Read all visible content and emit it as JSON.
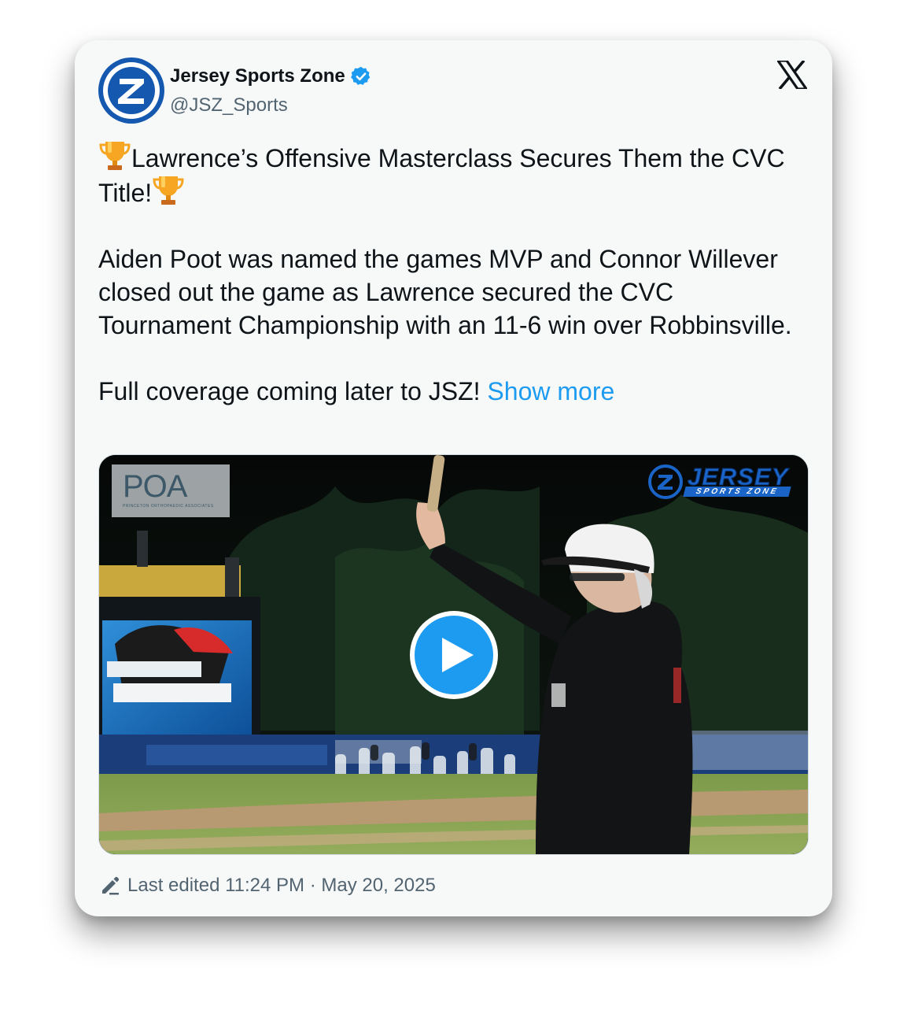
{
  "author": {
    "display_name": "Jersey Sports Zone",
    "handle": "@JSZ_Sports",
    "verified": true,
    "avatar_icon": "jsz-z-logo",
    "verified_icon": "verified-badge-icon",
    "platform_icon": "x-logo-icon"
  },
  "tweet": {
    "headline_text": "Lawrence’s Offensive Masterclass Secures Them the CVC Title!",
    "headline_icon": "trophy-emoji",
    "paragraph_text": "Aiden Poot was named the games MVP and Connor Willever closed out the game as Lawrence secured the CVC Tournament Championship with an 11-6 win over Robbinsville.",
    "closing_text": "Full coverage coming later to JSZ!",
    "show_more_label": "Show more"
  },
  "media": {
    "type": "video",
    "play_icon": "play-icon",
    "poa_watermark": "POA",
    "poa_subtitle": "PRINCETON ORTHOPAEDIC ASSOCIATES",
    "jsz_watermark_main": "JERSEY",
    "jsz_watermark_sub": "SPORTS ZONE"
  },
  "footer": {
    "edit_icon": "pencil-icon",
    "edited_text": "Last edited 11:24 PM · May 20, 2025"
  },
  "colors": {
    "link_blue": "#1d9bf0",
    "text_primary": "#0f1419",
    "text_secondary": "#536471",
    "card_background": "#f7f9f9",
    "avatar_blue": "#1558b0"
  }
}
